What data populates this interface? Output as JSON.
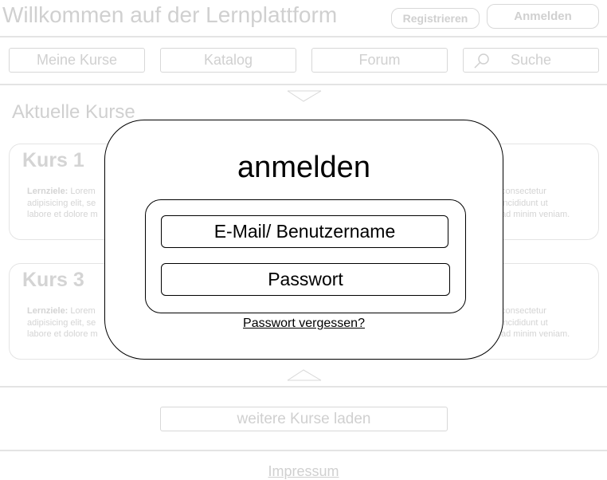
{
  "header": {
    "title": "Willkommen auf der Lernplattform",
    "register_label": "Registrieren",
    "login_label": "Anmelden"
  },
  "nav": {
    "items": [
      {
        "label": "Meine Kurse"
      },
      {
        "label": "Katalog"
      },
      {
        "label": "Forum"
      },
      {
        "label": "Suche",
        "icon": "search-icon"
      }
    ]
  },
  "main": {
    "section_title": "Aktuelle Kurse",
    "cards": [
      {
        "title": "Kurs 1",
        "text_label": "Lernziele:",
        "text_left_1": "Lorem",
        "text_left_2": "adipisicing elit, se",
        "text_left_3": "labore et dolore m",
        "text_right_1": "consectetur",
        "text_right_2": "incididunt ut",
        "text_right_3": "ad minim veniam."
      },
      {
        "title": "Kurs 3",
        "text_label": "Lernziele:",
        "text_left_1": "Lorem",
        "text_left_2": "adipisicing elit, se",
        "text_left_3": "labore et dolore m",
        "text_right_1": "consectetur",
        "text_right_2": "incididunt ut",
        "text_right_3": "ad minim veniam."
      }
    ],
    "load_more_label": "weitere Kurse laden"
  },
  "footer": {
    "impressum_label": "Impressum"
  },
  "modal": {
    "title": "anmelden",
    "user_field_label": "E-Mail/ Benutzername",
    "password_field_label": "Passwort",
    "forgot_label": "Passwort vergessen?"
  }
}
